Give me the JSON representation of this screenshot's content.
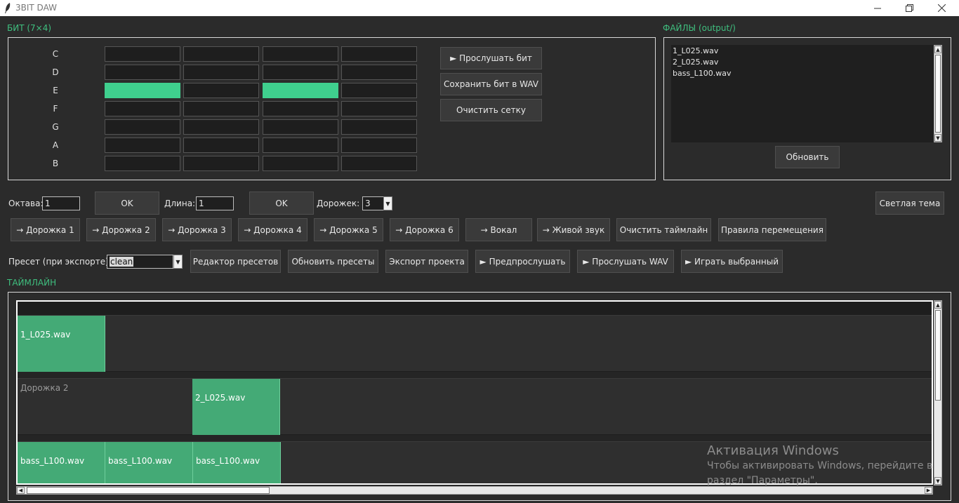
{
  "window": {
    "title": "3BIT DAW"
  },
  "beat": {
    "label": "БИТ (7×4)",
    "notes": [
      "C",
      "D",
      "E",
      "F",
      "G",
      "A",
      "B"
    ],
    "active_cells": [
      [
        2,
        0
      ],
      [
        2,
        2
      ]
    ],
    "buttons": {
      "play": "► Прослушать бит",
      "save_wav": "Сохранить бит в WAV",
      "clear": "Очистить сетку"
    }
  },
  "files": {
    "label": "ФАЙЛЫ (output/)",
    "items": [
      "1_L025.wav",
      "2_L025.wav",
      "bass_L100.wav"
    ],
    "refresh": "Обновить"
  },
  "controls": {
    "octave_label": "Октава:",
    "octave_value": "1",
    "ok1": "OK",
    "length_label": "Длина:",
    "length_value": "1",
    "ok2": "OK",
    "tracks_label": "Дорожек:",
    "tracks_value": "3",
    "theme": "Светлая тема"
  },
  "route_buttons": [
    "→ Дорожка 1",
    "→ Дорожка 2",
    "→ Дорожка 3",
    "→ Дорожка 4",
    "→ Дорожка 5",
    "→ Дорожка 6",
    "→ Вокал",
    "→ Живой звук",
    "Очистить таймлайн",
    "Правила перемещения"
  ],
  "preset": {
    "label": "Пресет (при экспорте):",
    "value": "clean",
    "buttons": [
      "Редактор пресетов",
      "Обновить пресеты",
      "Экспорт проекта",
      "► Предпрослушать",
      "► Прослушать WAV",
      "► Играть выбранный"
    ]
  },
  "timeline": {
    "label": "ТАЙМЛАЙН",
    "tracks": [
      {
        "name": "",
        "clips": [
          "1_L025.wav"
        ]
      },
      {
        "name": "Дорожка 2",
        "clips": [
          "2_L025.wav"
        ]
      },
      {
        "name": "",
        "clips": [
          "bass_L100.wav",
          "bass_L100.wav",
          "bass_L100.wav"
        ]
      }
    ]
  },
  "watermark": {
    "title": "Активация Windows",
    "line1": "Чтобы активировать Windows, перейдите в",
    "line2": "раздел \"Параметры\"."
  },
  "colors": {
    "accent": "#3fbf7f",
    "clip": "#44aa76",
    "active_cell": "#3fcf8e",
    "background": "#2b2b2b"
  }
}
